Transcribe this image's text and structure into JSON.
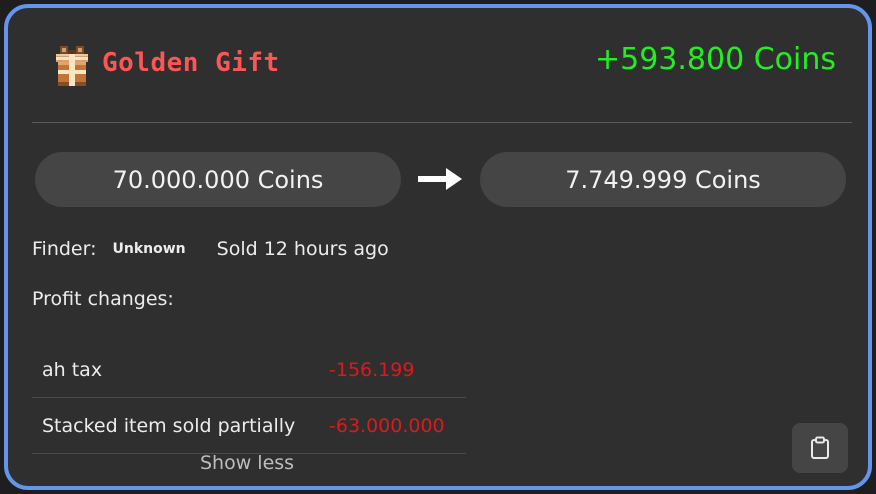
{
  "header": {
    "icon": "gift-icon",
    "item_name": "Golden Gift",
    "profit": "+593.800 Coins"
  },
  "prices": {
    "buy": "70.000.000 Coins",
    "sell": "7.749.999 Coins",
    "arrow_icon": "arrow-right-icon"
  },
  "details": {
    "finder_label": "Finder:",
    "finder_name": "Unknown",
    "sold_time": "Sold 12 hours ago"
  },
  "profit_changes": {
    "title": "Profit changes:",
    "items": [
      {
        "label": "ah tax",
        "value": "-156.199"
      },
      {
        "label": "Stacked item sold partially",
        "value": "-63.000.000"
      }
    ],
    "toggle_label": "Show less"
  },
  "actions": {
    "copy_icon": "clipboard-icon"
  },
  "colors": {
    "border": "#6495ed",
    "card_bg": "#2f2f2f",
    "item_name": "#ff5555",
    "profit_positive": "#22ee22",
    "profit_negative": "#dd1a1a"
  }
}
